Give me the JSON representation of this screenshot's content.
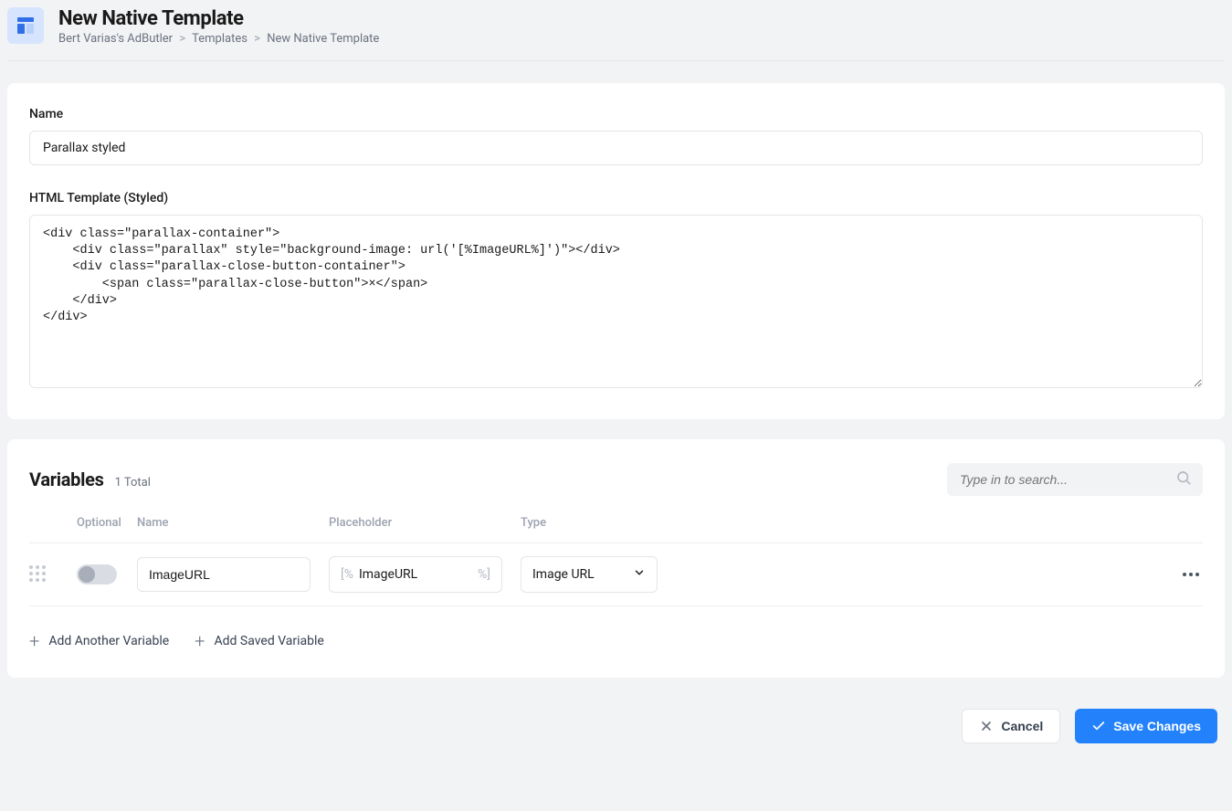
{
  "header": {
    "title": "New Native Template",
    "breadcrumb": {
      "root": "Bert Varias's AdButler",
      "mid": "Templates",
      "leaf": "New Native Template"
    }
  },
  "form": {
    "name_label": "Name",
    "name_value": "Parallax styled",
    "html_label": "HTML Template (Styled)",
    "html_value": "<div class=\"parallax-container\">\n    <div class=\"parallax\" style=\"background-image: url('[%ImageURL%]')\"></div>\n    <div class=\"parallax-close-button-container\">\n        <span class=\"parallax-close-button\">×</span>\n    </div>\n</div>"
  },
  "variables": {
    "heading": "Variables",
    "count": "1 Total",
    "search_placeholder": "Type in to search...",
    "columns": {
      "optional": "Optional",
      "name": "Name",
      "placeholder": "Placeholder",
      "type": "Type"
    },
    "rows": [
      {
        "name": "ImageURL",
        "placeholder": "ImageURL",
        "type": "Image URL",
        "optional": false
      }
    ],
    "add_another": "Add Another Variable",
    "add_saved": "Add Saved Variable",
    "bracket_left": "[%",
    "bracket_right": "%]"
  },
  "footer": {
    "cancel": "Cancel",
    "save": "Save Changes"
  }
}
